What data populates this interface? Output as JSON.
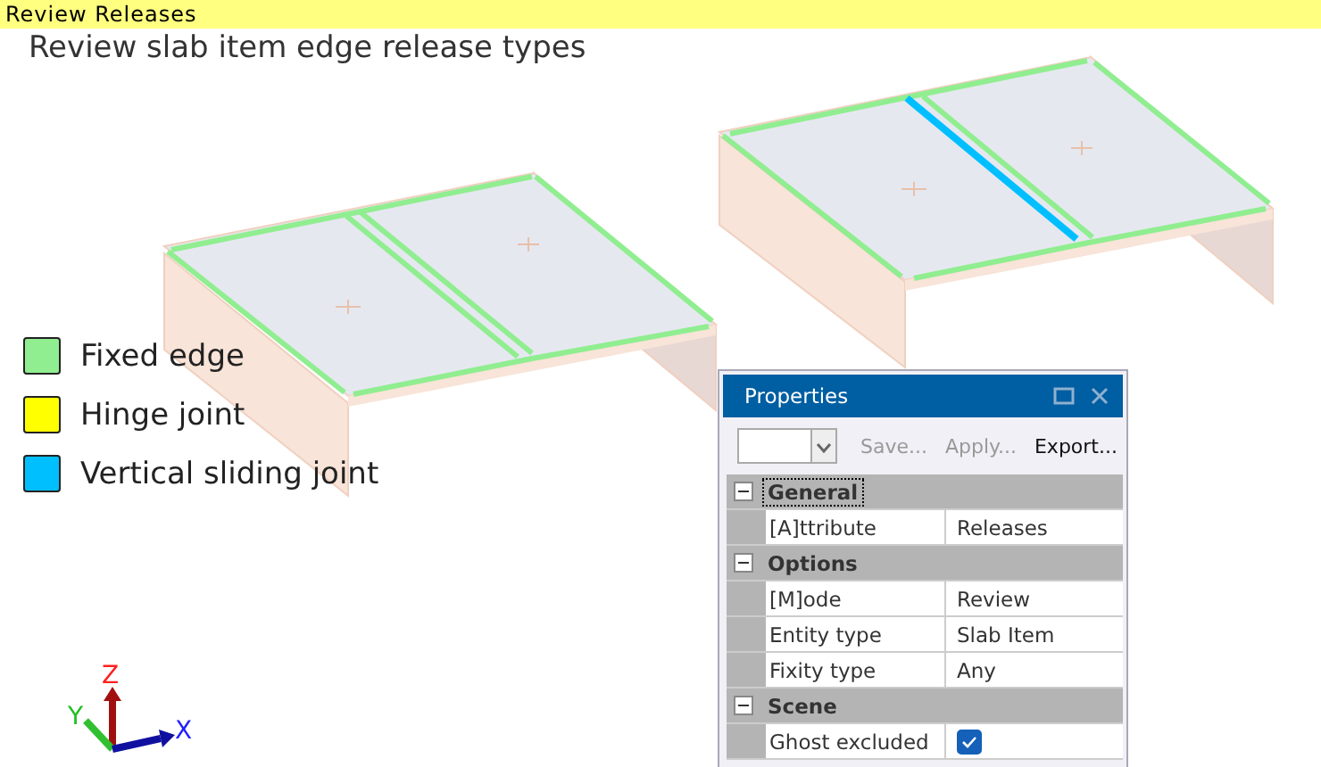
{
  "title_bar": {
    "title": "Review Releases"
  },
  "viewport": {
    "heading": "Review slab item edge release types",
    "legend": [
      {
        "label": "Fixed edge",
        "color": "#90ee90"
      },
      {
        "label": "Hinge joint",
        "color": "#ffff00"
      },
      {
        "label": "Vertical sliding joint",
        "color": "#00bfff"
      }
    ],
    "axes": {
      "x": "X",
      "y": "Y",
      "z": "Z"
    }
  },
  "properties": {
    "title": "Properties",
    "toolbar": [
      {
        "label": "Save...",
        "disabled": true
      },
      {
        "label": "Apply...",
        "disabled": true
      },
      {
        "label": "Export...",
        "disabled": false
      }
    ],
    "groups": [
      {
        "name": "General",
        "expanded": true,
        "rows": [
          {
            "kind": "text",
            "label": "[A]ttribute",
            "value": "Releases"
          }
        ]
      },
      {
        "name": "Options",
        "expanded": true,
        "rows": [
          {
            "kind": "text",
            "label": "[M]ode",
            "value": "Review"
          },
          {
            "kind": "text",
            "label": "Entity type",
            "value": "Slab Item"
          },
          {
            "kind": "text",
            "label": "Fixity type",
            "value": "Any"
          }
        ]
      },
      {
        "name": "Scene",
        "expanded": true,
        "rows": [
          {
            "kind": "checkbox",
            "label": "Ghost excluded",
            "checked": true
          }
        ]
      }
    ]
  }
}
